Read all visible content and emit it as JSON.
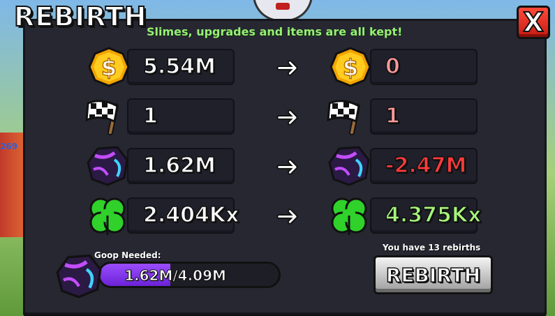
{
  "title": "REBIRTH",
  "close_label": "X",
  "subtitle": "Slimes, upgrades and items are all kept!",
  "rows": [
    {
      "icon": "coin-icon",
      "current": "5.54M",
      "after": "0",
      "after_color": "#ff9a9a"
    },
    {
      "icon": "checkered-flag-icon",
      "current": "1",
      "after": "1",
      "after_color": "#ff9a9a"
    },
    {
      "icon": "goop-crystal-icon",
      "current": "1.62M",
      "after": "-2.47M",
      "after_color": "#ff3b3b"
    },
    {
      "icon": "clover-icon",
      "current": "2.404Kx",
      "after": "4.375Kx",
      "after_color": "#a6f57c"
    }
  ],
  "goop": {
    "label": "Goop Needed:",
    "progress_text": "1.62M/4.09M",
    "fraction": 0.396
  },
  "rebirth": {
    "count_text": "You have 13 rebirths",
    "button_label": "REBIRTH"
  },
  "colors": {
    "accent_green": "#97ef76",
    "close_red": "#e0261a",
    "goop_purple": "#8a3cf0",
    "current_value": "#ffffff"
  }
}
